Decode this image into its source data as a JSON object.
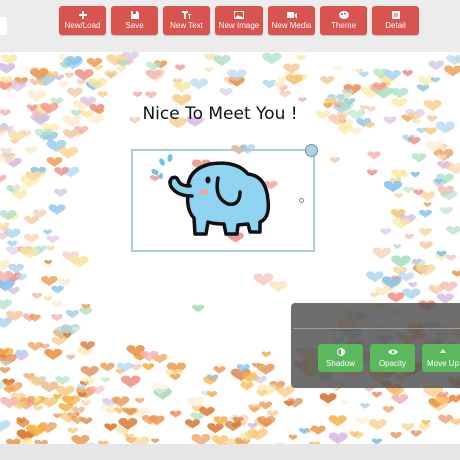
{
  "toolbar": {
    "buttons": [
      {
        "label": "New/Load",
        "icon": "plus-icon"
      },
      {
        "label": "Save",
        "icon": "save-icon"
      },
      {
        "label": "New Text",
        "icon": "text-icon"
      },
      {
        "label": "New Image",
        "icon": "image-icon"
      },
      {
        "label": "New Media",
        "icon": "video-icon"
      },
      {
        "label": "Theme",
        "icon": "palette-icon"
      },
      {
        "label": "Detail",
        "icon": "note-icon"
      }
    ]
  },
  "canvas": {
    "title": "Nice To Meet You !",
    "image": "elephant-sticker"
  },
  "effects_panel": {
    "buttons": [
      {
        "label": "Shadow",
        "icon": "half-circle-icon"
      },
      {
        "label": "Opacity",
        "icon": "eye-icon"
      },
      {
        "label": "Move Up",
        "icon": "arrow-up-icon"
      }
    ]
  },
  "colors": {
    "toolbar_button": "#d9534f",
    "panel_button": "#5cb85c",
    "selection_border": "#a8d0dc"
  }
}
